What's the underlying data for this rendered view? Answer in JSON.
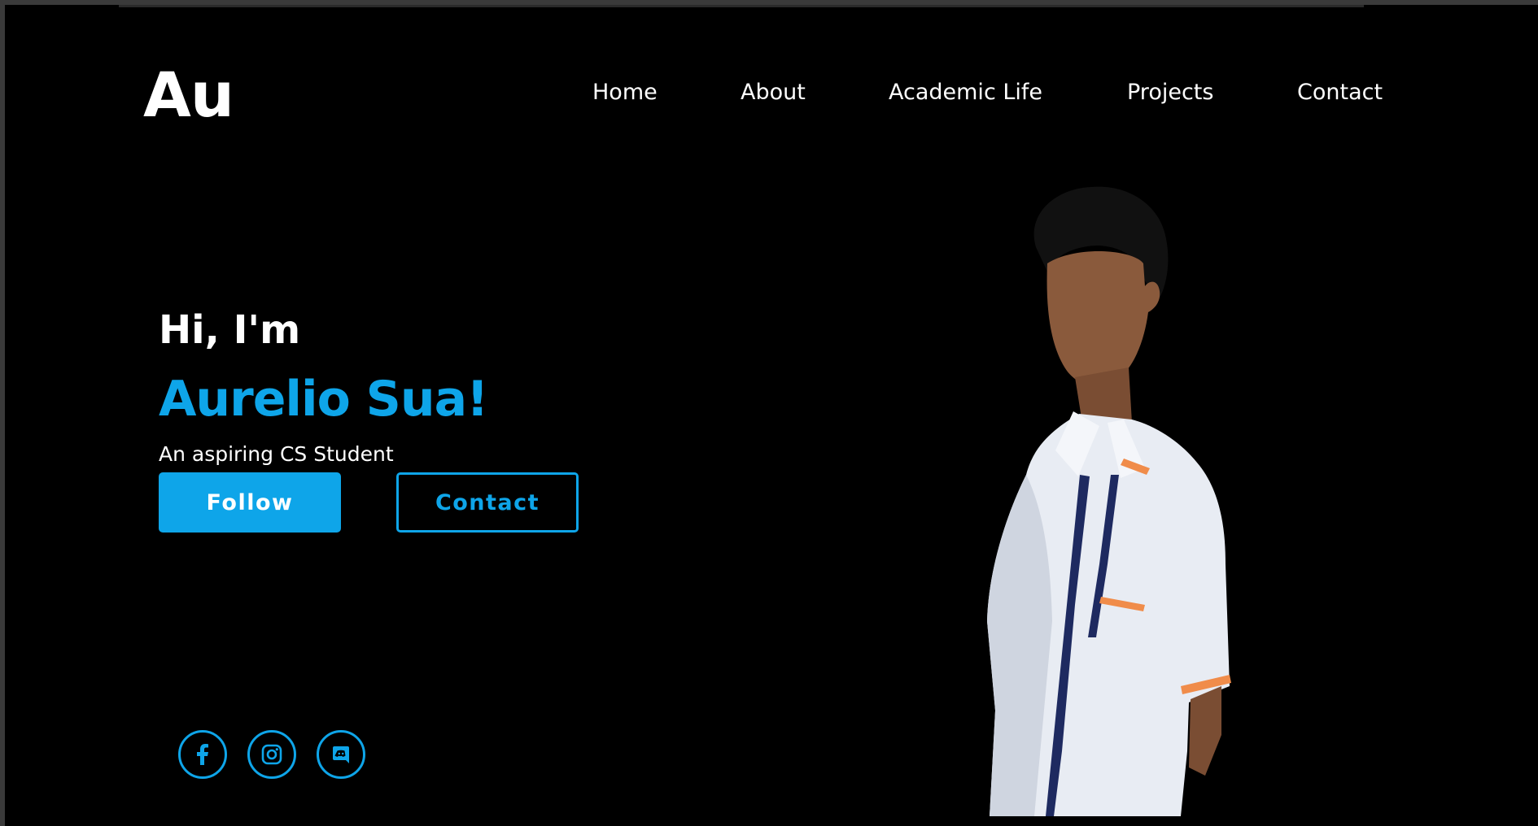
{
  "header": {
    "logo": "Au",
    "nav": [
      {
        "label": "Home"
      },
      {
        "label": "About"
      },
      {
        "label": "Academic Life"
      },
      {
        "label": "Projects"
      },
      {
        "label": "Contact"
      }
    ]
  },
  "hero": {
    "greeting": "Hi, I'm",
    "name": "Aurelio Sua!",
    "tagline": "An aspiring CS Student",
    "follow_label": "Follow",
    "contact_label": "Contact"
  },
  "socials": [
    {
      "icon": "facebook-icon"
    },
    {
      "icon": "instagram-icon"
    },
    {
      "icon": "discord-icon"
    }
  ],
  "colors": {
    "accent": "#0ea5e9",
    "background": "#000000",
    "text": "#ffffff"
  }
}
